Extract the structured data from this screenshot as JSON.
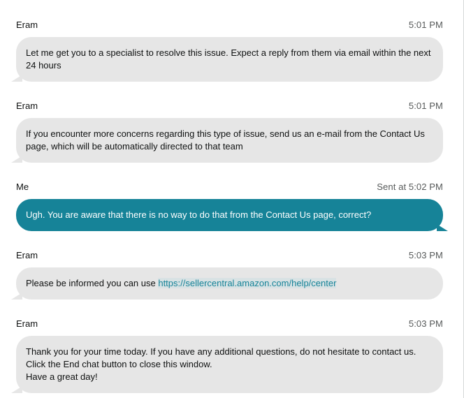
{
  "messages": [
    {
      "sender": "Eram",
      "time": "5:01 PM",
      "text": "Let me get you to a specialist to resolve this issue. Expect a reply from them via email within the next 24 hours"
    },
    {
      "sender": "Eram",
      "time": "5:01 PM",
      "text": "If you encounter more concerns regarding this type of issue, send us an e-mail from the Contact Us page, which will be automatically directed to that team"
    },
    {
      "sender": "Me",
      "time": "Sent at 5:02 PM",
      "text": "Ugh. You are aware that there is no way to do that from the Contact Us page, correct?"
    },
    {
      "sender": "Eram",
      "time": "5:03 PM",
      "text_prefix": "Please be informed you can use ",
      "link": "https://sellercentral.amazon.com/help/center"
    },
    {
      "sender": "Eram",
      "time": "5:03 PM",
      "lines": [
        "Thank you for your time today. If you have any additional questions, do not hesitate to contact us.",
        "Click the End chat button to close this window.",
        "Have a great day!"
      ]
    }
  ],
  "colors": {
    "incoming_bubble": "#e6e6e6",
    "outgoing_bubble": "#168398",
    "link": "#168398"
  }
}
